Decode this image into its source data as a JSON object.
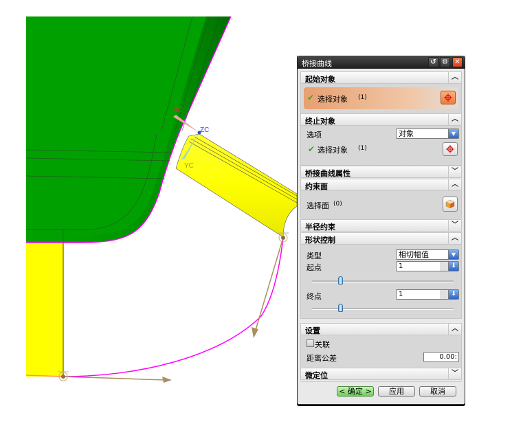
{
  "viewport": {
    "axis_labels": {
      "xc": "XC",
      "yc": "YC",
      "zc": "ZC"
    },
    "colors": {
      "body": "#00a000",
      "tube": "#ffff00",
      "bridge_curve": "#ff00ff",
      "vector": "#a89060"
    }
  },
  "dialog": {
    "title": "桥接曲线",
    "titlebar_icons": [
      "reset-icon",
      "settings-icon",
      "close-icon"
    ],
    "sections": {
      "start_object": {
        "header": "起始对象",
        "expanded": true,
        "select_label": "选择对象",
        "select_count": "(1)"
      },
      "end_object": {
        "header": "终止对象",
        "expanded": true,
        "option_label": "选项",
        "option_value": "对象",
        "select_label": "选择对象",
        "select_count": "(1)"
      },
      "bridge_props": {
        "header": "桥接曲线属性",
        "expanded": false
      },
      "constraint_face": {
        "header": "约束面",
        "expanded": true,
        "select_label": "选择面",
        "select_count": "(0)"
      },
      "radius_constraint": {
        "header": "半径约束",
        "expanded": false
      },
      "shape_control": {
        "header": "形状控制",
        "expanded": true,
        "type_label": "类型",
        "type_value": "相切幅值",
        "start_label": "起点",
        "start_value": "1",
        "start_slider_fraction": 0.2,
        "end_label": "终点",
        "end_value": "1",
        "end_slider_fraction": 0.2
      },
      "settings": {
        "header": "设置",
        "expanded": true,
        "associative_label": "关联",
        "associative_checked": false,
        "tolerance_label": "距离公差",
        "tolerance_value": "0.00:"
      },
      "fine_position": {
        "header": "微定位",
        "expanded": false
      }
    },
    "buttons": {
      "ok": "< 确定 >",
      "apply": "应用",
      "cancel": "取消"
    }
  }
}
